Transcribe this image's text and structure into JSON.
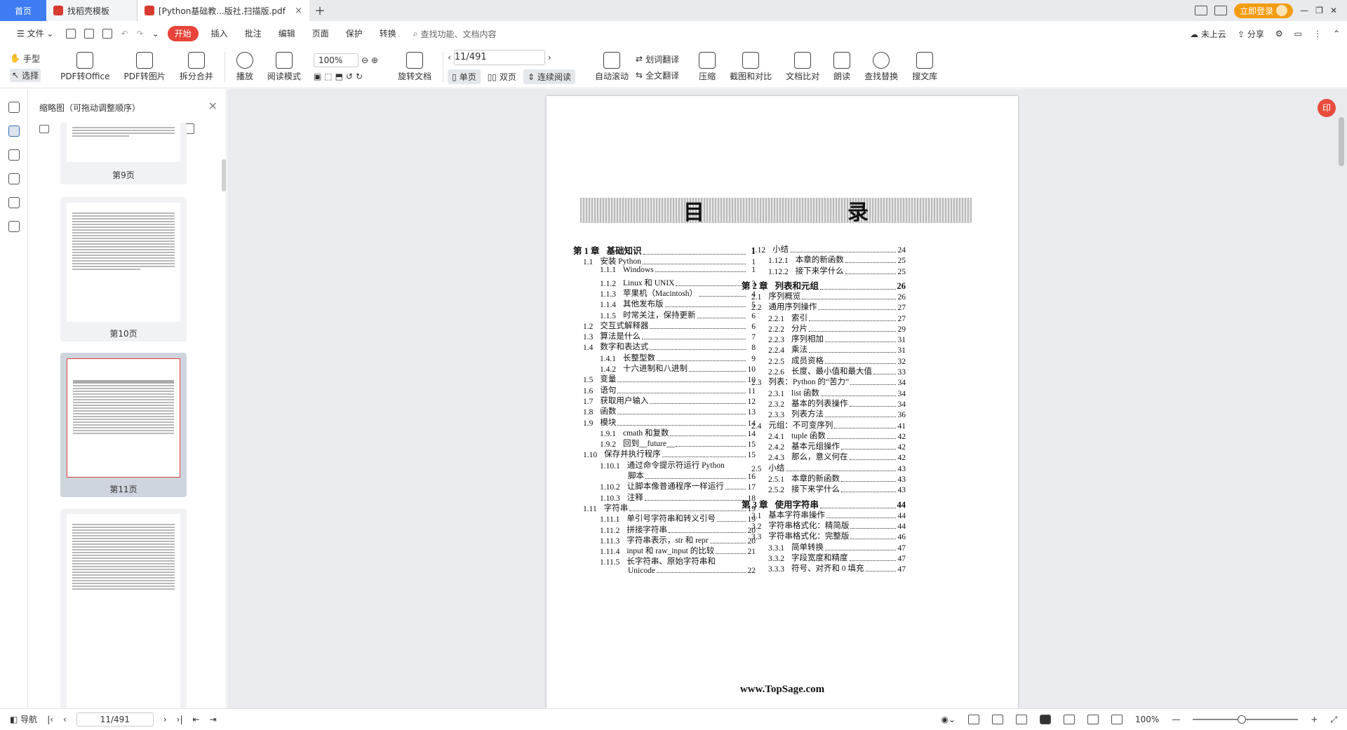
{
  "tabs": {
    "home": "首页",
    "tab1": "找稻壳模板",
    "tab2": "[Python基础教...版社.扫描版.pdf",
    "login": "立即登录"
  },
  "menubar": {
    "file": "文件",
    "items": [
      "开始",
      "插入",
      "批注",
      "编辑",
      "页面",
      "保护",
      "转换"
    ],
    "search_placeholder": "查找功能、文档内容",
    "cloud": "未上云",
    "share": "分享"
  },
  "toolbar": {
    "hand": "手型",
    "select": "选择",
    "pdf_office": "PDF转Office",
    "pdf_image": "PDF转图片",
    "split_merge": "拆分合并",
    "play": "播放",
    "read_mode": "阅读模式",
    "zoom": "100%",
    "rotate": "旋转文档",
    "page_input": "11/491",
    "single": "单页",
    "double": "双页",
    "continuous": "连续阅读",
    "auto_scroll": "自动滚动",
    "word_translate": "划词翻译",
    "full_translate": "全文翻译",
    "compress": "压缩",
    "screenshot_compare": "截图和对比",
    "doc_compare": "文档比对",
    "read_aloud": "朗读",
    "find_replace": "查找替换",
    "library": "搜文库"
  },
  "thumbnails": {
    "title": "缩略图（可拖动调整顺序）",
    "pages": [
      "第9页",
      "第10页",
      "第11页"
    ]
  },
  "document": {
    "title": "目　　录",
    "footer": "www.TopSage.com",
    "left_col": [
      {
        "num": "第 1 章",
        "text": "基础知识",
        "page": "1",
        "level": 0
      },
      {
        "num": "1.1",
        "text": "安装 Python",
        "page": "1",
        "level": 1
      },
      {
        "num": "1.1.1",
        "text": "Windows",
        "page": "1",
        "level": 2
      },
      {
        "num": "1.1.2",
        "text": "Linux 和 UNIX",
        "page": "3",
        "level": 2
      },
      {
        "num": "1.1.3",
        "text": "苹果机（Macintosh）",
        "page": "4",
        "level": 2
      },
      {
        "num": "1.1.4",
        "text": "其他发布版",
        "page": "5",
        "level": 2
      },
      {
        "num": "1.1.5",
        "text": "时常关注，保持更新",
        "page": "6",
        "level": 2
      },
      {
        "num": "1.2",
        "text": "交互式解释器",
        "page": "6",
        "level": 1
      },
      {
        "num": "1.3",
        "text": "算法是什么",
        "page": "7",
        "level": 1
      },
      {
        "num": "1.4",
        "text": "数字和表达式",
        "page": "8",
        "level": 1
      },
      {
        "num": "1.4.1",
        "text": "长整型数",
        "page": "9",
        "level": 2
      },
      {
        "num": "1.4.2",
        "text": "十六进制和八进制",
        "page": "10",
        "level": 2
      },
      {
        "num": "1.5",
        "text": "变量",
        "page": "10",
        "level": 1
      },
      {
        "num": "1.6",
        "text": "语句",
        "page": "11",
        "level": 1
      },
      {
        "num": "1.7",
        "text": "获取用户输入",
        "page": "12",
        "level": 1
      },
      {
        "num": "1.8",
        "text": "函数",
        "page": "13",
        "level": 1
      },
      {
        "num": "1.9",
        "text": "模块",
        "page": "14",
        "level": 1
      },
      {
        "num": "1.9.1",
        "text": "cmath 和复数",
        "page": "14",
        "level": 2
      },
      {
        "num": "1.9.2",
        "text": "回到__future__",
        "page": "15",
        "level": 2
      },
      {
        "num": "1.10",
        "text": "保存并执行程序",
        "page": "15",
        "level": 1
      },
      {
        "num": "1.10.1",
        "text": "通过命令提示符运行 Python",
        "page": "",
        "level": 2
      },
      {
        "num": "",
        "text": "脚本",
        "page": "16",
        "level": 3
      },
      {
        "num": "1.10.2",
        "text": "让脚本像普通程序一样运行",
        "page": "17",
        "level": 2
      },
      {
        "num": "1.10.3",
        "text": "注释",
        "page": "18",
        "level": 2
      },
      {
        "num": "1.11",
        "text": "字符串",
        "page": "19",
        "level": 1
      },
      {
        "num": "1.11.1",
        "text": "单引号字符串和转义引号",
        "page": "19",
        "level": 2
      },
      {
        "num": "1.11.2",
        "text": "拼接字符串",
        "page": "20",
        "level": 2
      },
      {
        "num": "1.11.3",
        "text": "字符串表示，str 和 repr",
        "page": "20",
        "level": 2
      },
      {
        "num": "1.11.4",
        "text": "input 和 raw_input 的比较",
        "page": "21",
        "level": 2
      },
      {
        "num": "1.11.5",
        "text": "长字符串、原始字符串和",
        "page": "",
        "level": 2
      },
      {
        "num": "",
        "text": "Unicode",
        "page": "22",
        "level": 3
      }
    ],
    "right_col": [
      {
        "num": "1.12",
        "text": "小结",
        "page": "24",
        "level": 1
      },
      {
        "num": "1.12.1",
        "text": "本章的新函数",
        "page": "25",
        "level": 2
      },
      {
        "num": "1.12.2",
        "text": "接下来学什么",
        "page": "25",
        "level": 2
      },
      {
        "num": "第 2 章",
        "text": "列表和元组",
        "page": "26",
        "level": 0
      },
      {
        "num": "2.1",
        "text": "序列概览",
        "page": "26",
        "level": 1
      },
      {
        "num": "2.2",
        "text": "通用序列操作",
        "page": "27",
        "level": 1
      },
      {
        "num": "2.2.1",
        "text": "索引",
        "page": "27",
        "level": 2
      },
      {
        "num": "2.2.2",
        "text": "分片",
        "page": "29",
        "level": 2
      },
      {
        "num": "2.2.3",
        "text": "序列相加",
        "page": "31",
        "level": 2
      },
      {
        "num": "2.2.4",
        "text": "乘法",
        "page": "31",
        "level": 2
      },
      {
        "num": "2.2.5",
        "text": "成员资格",
        "page": "32",
        "level": 2
      },
      {
        "num": "2.2.6",
        "text": "长度、最小值和最大值",
        "page": "33",
        "level": 2
      },
      {
        "num": "2.3",
        "text": "列表：Python 的“苦力”",
        "page": "34",
        "level": 1
      },
      {
        "num": "2.3.1",
        "text": "list 函数",
        "page": "34",
        "level": 2
      },
      {
        "num": "2.3.2",
        "text": "基本的列表操作",
        "page": "34",
        "level": 2
      },
      {
        "num": "2.3.3",
        "text": "列表方法",
        "page": "36",
        "level": 2
      },
      {
        "num": "2.4",
        "text": "元组：不可变序列",
        "page": "41",
        "level": 1
      },
      {
        "num": "2.4.1",
        "text": "tuple 函数",
        "page": "42",
        "level": 2
      },
      {
        "num": "2.4.2",
        "text": "基本元组操作",
        "page": "42",
        "level": 2
      },
      {
        "num": "2.4.3",
        "text": "那么，意义何在",
        "page": "42",
        "level": 2
      },
      {
        "num": "2.5",
        "text": "小结",
        "page": "43",
        "level": 1
      },
      {
        "num": "2.5.1",
        "text": "本章的新函数",
        "page": "43",
        "level": 2
      },
      {
        "num": "2.5.2",
        "text": "接下来学什么",
        "page": "43",
        "level": 2
      },
      {
        "num": "第 3 章",
        "text": "使用字符串",
        "page": "44",
        "level": 0
      },
      {
        "num": "3.1",
        "text": "基本字符串操作",
        "page": "44",
        "level": 1
      },
      {
        "num": "3.2",
        "text": "字符串格式化：精简版",
        "page": "44",
        "level": 1
      },
      {
        "num": "3.3",
        "text": "字符串格式化：完整版",
        "page": "46",
        "level": 1
      },
      {
        "num": "3.3.1",
        "text": "简单转换",
        "page": "47",
        "level": 2
      },
      {
        "num": "3.3.2",
        "text": "字段宽度和精度",
        "page": "47",
        "level": 2
      },
      {
        "num": "3.3.3",
        "text": "符号、对齐和 0 填充",
        "page": "47",
        "level": 2
      }
    ]
  },
  "statusbar": {
    "nav": "导航",
    "page": "11/491",
    "zoom": "100%"
  }
}
